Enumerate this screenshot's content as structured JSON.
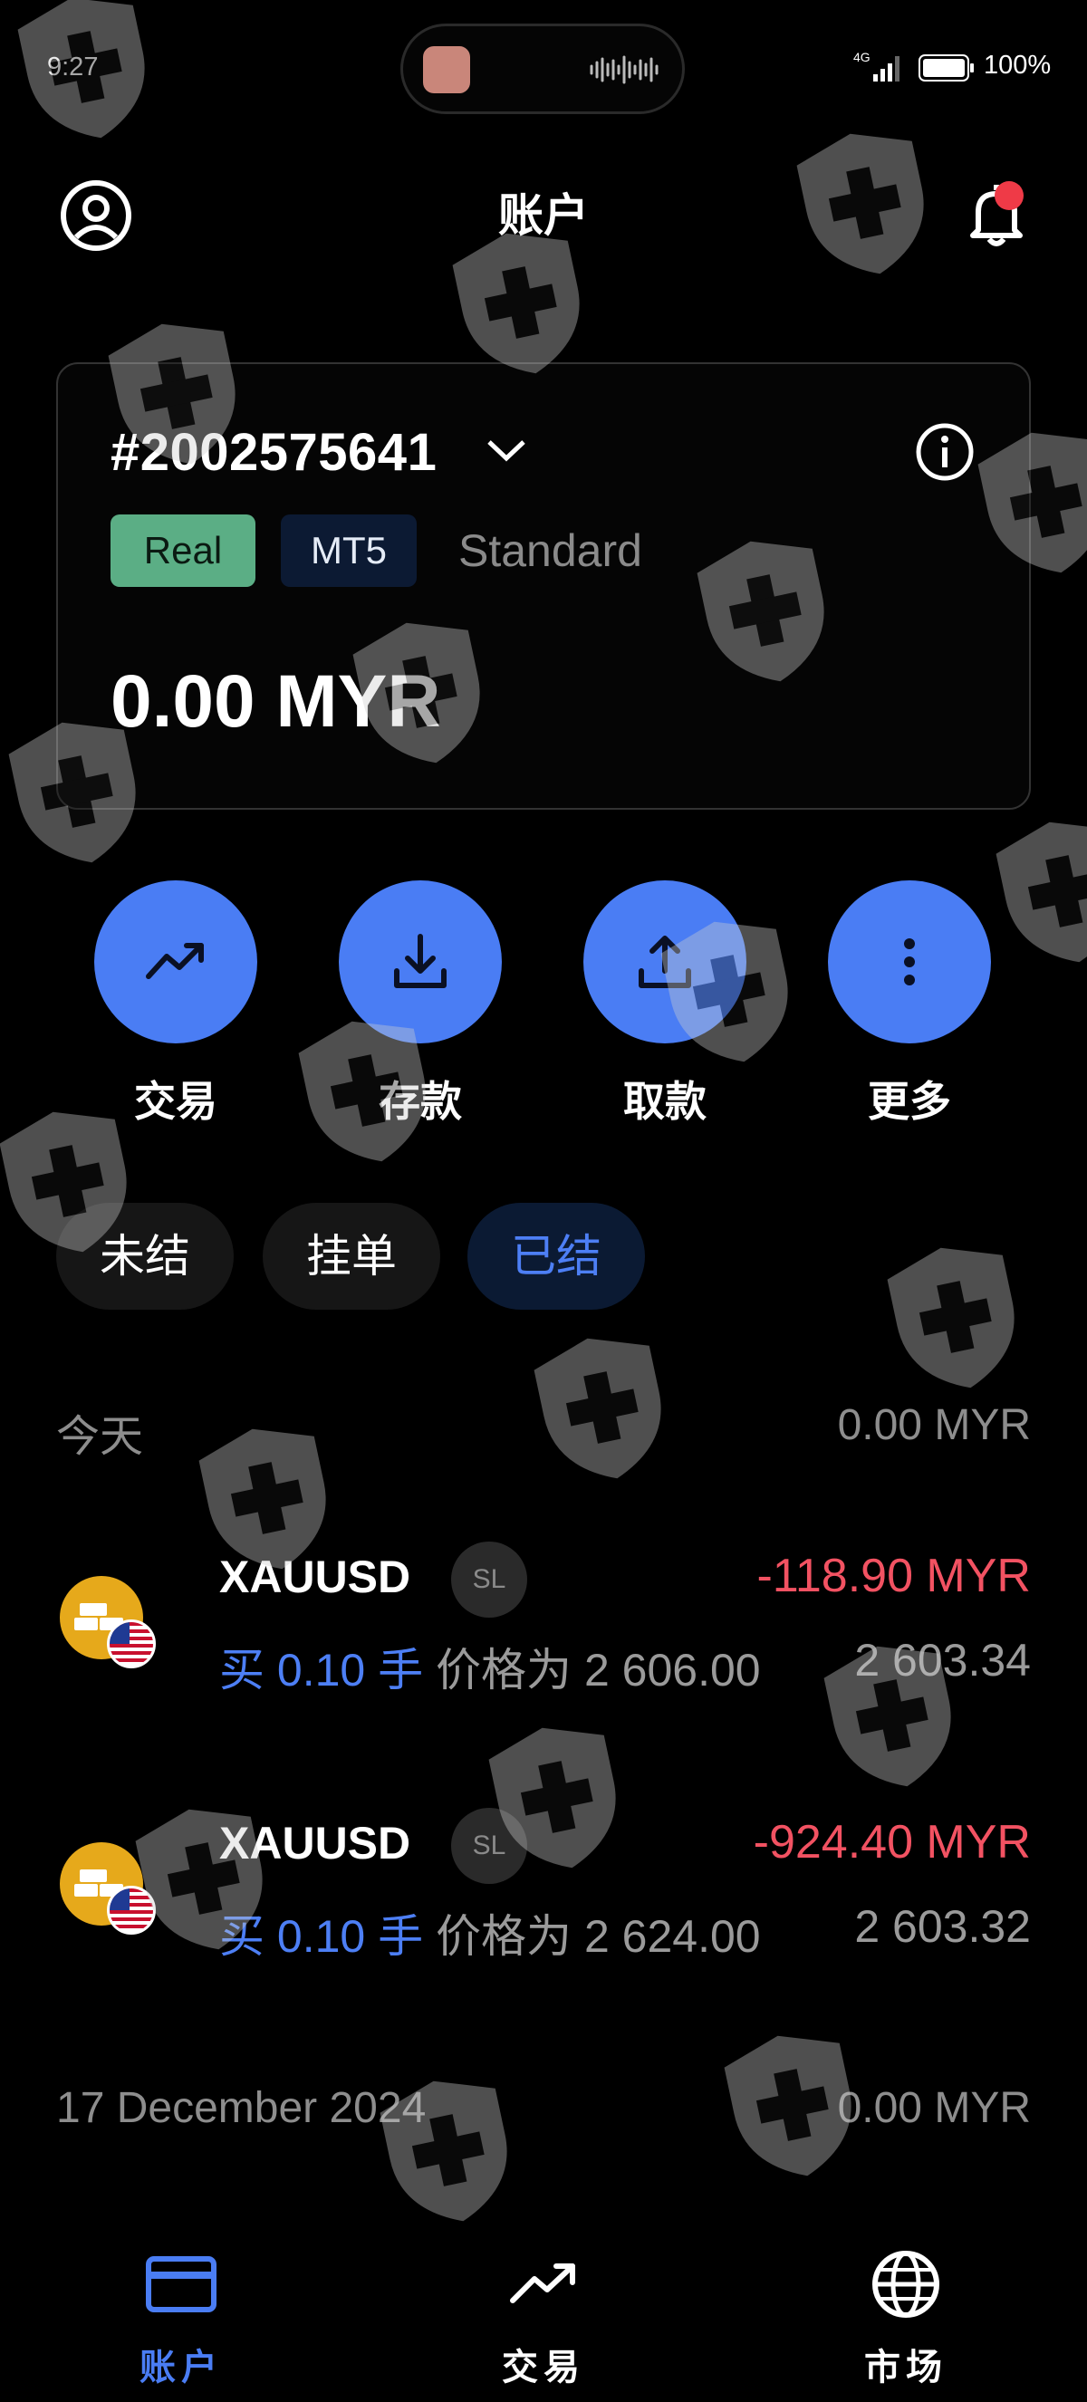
{
  "status_bar": {
    "time": "9:27",
    "network": "4G",
    "battery": "100%"
  },
  "header": {
    "title": "账户"
  },
  "account": {
    "number": "#2002575641",
    "badges": {
      "type": "Real",
      "platform": "MT5",
      "plan": "Standard"
    },
    "balance": "0.00 MYR"
  },
  "actions": [
    {
      "label": "交易",
      "icon": "trend-up-icon"
    },
    {
      "label": "存款",
      "icon": "download-icon"
    },
    {
      "label": "取款",
      "icon": "upload-icon"
    },
    {
      "label": "更多",
      "icon": "more-vertical-icon"
    }
  ],
  "tabs": [
    {
      "label": "未结"
    },
    {
      "label": "挂单"
    },
    {
      "label": "已结",
      "active": true
    }
  ],
  "history": {
    "today": {
      "label": "今天",
      "total": "0.00 MYR"
    },
    "trades": [
      {
        "symbol": "XAUUSD",
        "badge": "SL",
        "pnl": "-118.90 MYR",
        "side": "买",
        "volume": "0.10",
        "unit": "手",
        "price_label": "价格为",
        "open_price": "2 606.00",
        "close_price": "2 603.34"
      },
      {
        "symbol": "XAUUSD",
        "badge": "SL",
        "pnl": "-924.40 MYR",
        "side": "买",
        "volume": "0.10",
        "unit": "手",
        "price_label": "价格为",
        "open_price": "2 624.00",
        "close_price": "2 603.32"
      }
    ],
    "previous": {
      "label": "17 December 2024",
      "total": "0.00 MYR"
    }
  },
  "bottom_nav": [
    {
      "label": "账户",
      "icon": "card-icon",
      "active": true
    },
    {
      "label": "交易",
      "icon": "trend-up-icon"
    },
    {
      "label": "市场",
      "icon": "globe-icon"
    }
  ],
  "colors": {
    "accent": "#4a7df4",
    "loss": "#f25262",
    "real_badge": "#5bae85",
    "gold_coin": "#e6a91b",
    "background": "#000000"
  }
}
